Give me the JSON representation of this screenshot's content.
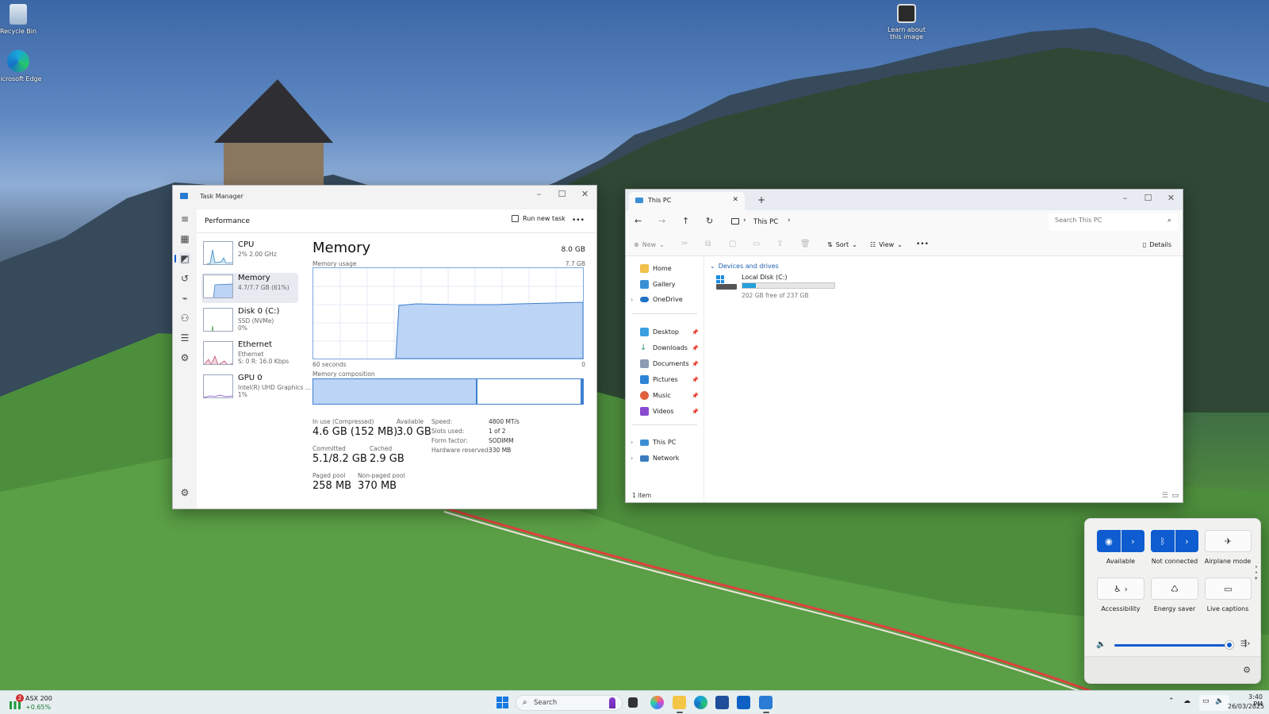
{
  "desktop": {
    "icons": [
      {
        "label": "Recycle Bin",
        "icon": "recycle-bin-icon"
      },
      {
        "label": "Microsoft Edge",
        "icon": "edge-icon"
      }
    ],
    "learn_line1": "Learn about",
    "learn_line2": "this image"
  },
  "task_manager": {
    "title": "Task Manager",
    "page": "Performance",
    "run_new_task": "Run new task",
    "more": "•••",
    "items": [
      {
        "name": "CPU",
        "sub1": "2% 2.00 GHz",
        "sub2": ""
      },
      {
        "name": "Memory",
        "sub1": "4.7/7.7 GB (61%)",
        "sub2": ""
      },
      {
        "name": "Disk 0 (C:)",
        "sub1": "SSD (NVMe)",
        "sub2": "0%"
      },
      {
        "name": "Ethernet",
        "sub1": "Ethernet",
        "sub2": "S: 0 R: 16.0 Kbps"
      },
      {
        "name": "GPU 0",
        "sub1": "Intel(R) UHD Graphics ...",
        "sub2": "1%"
      }
    ],
    "heading": "Memory",
    "total": "8.0 GB",
    "usage_label": "Memory usage",
    "usage_max": "7.7 GB",
    "time_left": "60 seconds",
    "time_right": "0",
    "composition_label": "Memory composition",
    "usage_fraction": 0.61,
    "stats": {
      "in_use_label": "In use (Compressed)",
      "in_use": "4.6 GB (152 MB)",
      "available_label": "Available",
      "available": "3.0 GB",
      "committed_label": "Committed",
      "committed": "5.1/8.2 GB",
      "cached_label": "Cached",
      "cached": "2.9 GB",
      "paged_label": "Paged pool",
      "paged": "258 MB",
      "nonpaged_label": "Non-paged pool",
      "nonpaged": "370 MB"
    },
    "details": {
      "speed_label": "Speed:",
      "speed": "4800 MT/s",
      "slots_label": "Slots used:",
      "slots": "1 of 2",
      "form_label": "Form factor:",
      "form": "SODIMM",
      "reserved_label": "Hardware reserved:",
      "reserved": "330 MB"
    }
  },
  "explorer": {
    "tab_title": "This PC",
    "new_tab": "+",
    "breadcrumb": "This PC",
    "search_placeholder": "Search This PC",
    "toolbar": {
      "new": "New",
      "sort": "Sort",
      "view": "View",
      "more": "•••",
      "details": "Details"
    },
    "nav": {
      "home": "Home",
      "gallery": "Gallery",
      "onedrive": "OneDrive",
      "desktop": "Desktop",
      "downloads": "Downloads",
      "documents": "Documents",
      "pictures": "Pictures",
      "music": "Music",
      "videos": "Videos",
      "thispc": "This PC",
      "network": "Network"
    },
    "section": "Devices and drives",
    "drive_name": "Local Disk (C:)",
    "drive_free": "202 GB free of 237 GB",
    "drive_used_fraction": 0.15,
    "status": "1 item"
  },
  "quick_settings": {
    "wifi": "Available",
    "bluetooth": "Not connected",
    "airplane": "Airplane mode",
    "accessibility": "Accessibility",
    "energy": "Energy saver",
    "captions": "Live captions",
    "volume_level": 0.98
  },
  "taskbar": {
    "stock_name": "ASX 200",
    "stock_change": "+0.65%",
    "badge": "2",
    "search": "Search",
    "time": "3:40 PM",
    "date": "26/03/2025",
    "colors": {
      "accent": "#0e5cd0",
      "memory_fill": "#bcd4f5",
      "memory_line": "#3f7fd0"
    }
  }
}
